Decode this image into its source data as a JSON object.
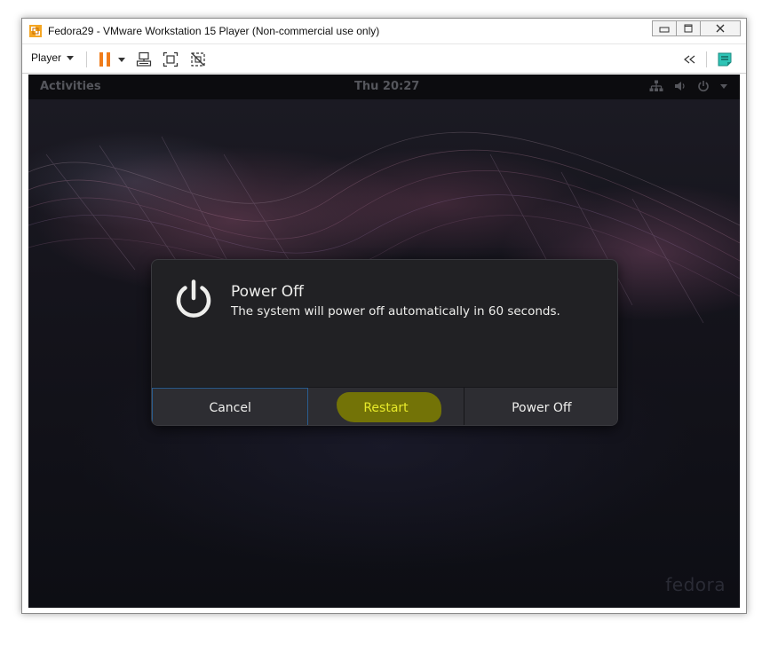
{
  "window": {
    "title": "Fedora29 - VMware Workstation 15 Player (Non-commercial use only)"
  },
  "toolbar": {
    "player_menu_label": "Player",
    "pause_color": "#f07c1a"
  },
  "guest": {
    "topbar": {
      "activities_label": "Activities",
      "clock": "Thu 20:27"
    },
    "dialog": {
      "title": "Power Off",
      "message": "The system will power off automatically in 60 seconds.",
      "buttons": {
        "cancel": "Cancel",
        "restart": "Restart",
        "power_off": "Power Off"
      },
      "restart_color": "#e8ea2a",
      "focus_border_color": "#2a5c8f"
    },
    "watermark": "fedora"
  },
  "icons": {
    "app": "vmware-icon",
    "minimize": "minimize-icon",
    "maximize": "maximize-icon",
    "close": "close-icon",
    "pause": "pause-icon",
    "send_ctrl_alt_del": "send-keys-icon",
    "fullscreen": "fullscreen-icon",
    "unity": "unity-icon",
    "collapse": "collapse-icon",
    "notes": "notes-icon",
    "network": "network-icon",
    "volume": "volume-icon",
    "power": "power-icon"
  }
}
